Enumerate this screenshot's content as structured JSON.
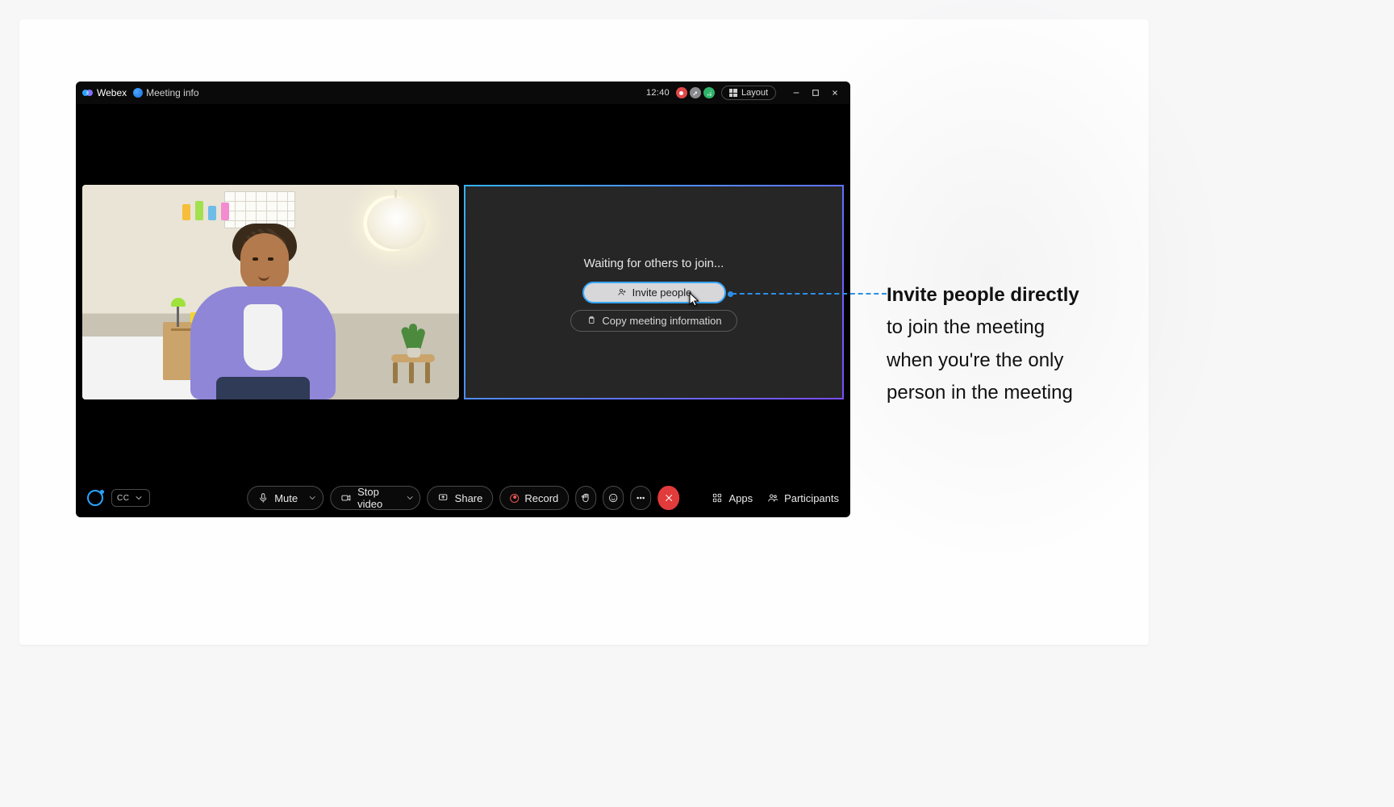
{
  "titlebar": {
    "app_name": "Webex",
    "meeting_info_label": "Meeting info",
    "clock": "12:40",
    "layout_label": "Layout"
  },
  "waiting_panel": {
    "status_text": "Waiting for others to join...",
    "invite_label": "Invite people",
    "copy_label": "Copy meeting information"
  },
  "bottombar": {
    "cc_label": "CC",
    "mute_label": "Mute",
    "stop_video_label": "Stop video",
    "share_label": "Share",
    "record_label": "Record",
    "apps_label": "Apps",
    "participants_label": "Participants"
  },
  "annotation": {
    "bold": "Invite people directly",
    "line2": "to join the meeting",
    "line3": "when you're the only",
    "line4": "person in the meeting"
  }
}
